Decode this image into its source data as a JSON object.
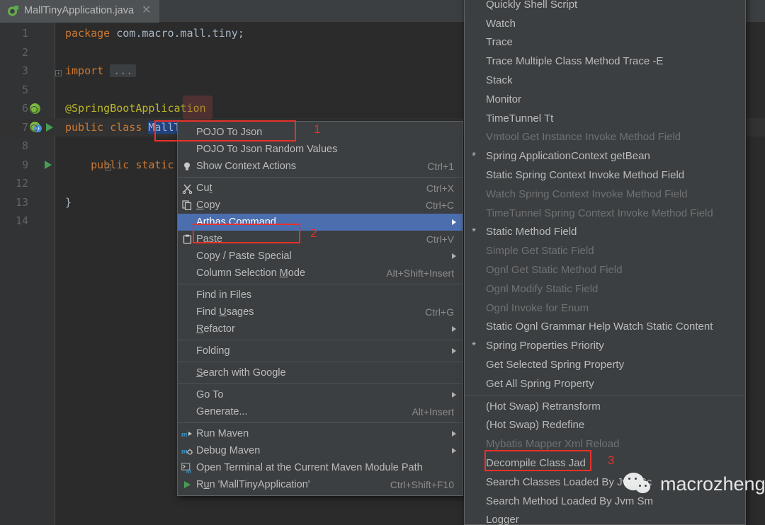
{
  "window": {
    "bg_color": "#2b2b2b",
    "accent_color": "#4b6eaf",
    "annotation_color": "#e8312a"
  },
  "editor": {
    "tab": {
      "label": "MallTinyApplication.java",
      "icon": "spring-boot-class-icon",
      "close_icon": "close-icon"
    },
    "lines": [
      {
        "num": "1",
        "tokens": [
          {
            "t": "package ",
            "c": "kw"
          },
          {
            "t": "com.macro.mall.tiny;",
            "c": "plain"
          }
        ]
      },
      {
        "num": "2",
        "tokens": []
      },
      {
        "num": "3",
        "tokens": [
          {
            "t": "import ",
            "c": "kw"
          },
          {
            "t": "...",
            "c": "fold"
          }
        ]
      },
      {
        "num": "5",
        "tokens": []
      },
      {
        "num": "6",
        "tokens": [
          {
            "t": "@SpringBootApplication",
            "c": "anno"
          }
        ]
      },
      {
        "num": "7",
        "tokens": [
          {
            "t": "public class ",
            "c": "kw"
          },
          {
            "t": "MallTinyApplication",
            "c": "sel"
          },
          {
            "t": " {",
            "c": "plain"
          }
        ]
      },
      {
        "num": "8",
        "tokens": []
      },
      {
        "num": "9",
        "tokens": [
          {
            "t": "    public static void main(String[] args);",
            "c": "kw9"
          }
        ]
      },
      {
        "num": "12",
        "tokens": []
      },
      {
        "num": "13",
        "tokens": [
          {
            "t": "}",
            "c": "plain"
          }
        ]
      },
      {
        "num": "14",
        "tokens": []
      }
    ]
  },
  "context_menu": {
    "items": [
      {
        "label": "POJO To Json",
        "icon": "",
        "shortcut": "",
        "type": "item"
      },
      {
        "label": "POJO To Json Random Values",
        "icon": "",
        "shortcut": "",
        "type": "item"
      },
      {
        "label": "Show Context Actions",
        "icon": "lightbulb-icon",
        "shortcut": "Ctrl+1",
        "type": "item"
      },
      {
        "type": "separator"
      },
      {
        "label": "Cut",
        "icon": "scissors-icon",
        "shortcut": "Ctrl+X",
        "type": "item",
        "mnemonic": "t"
      },
      {
        "label": "Copy",
        "icon": "copy-icon",
        "shortcut": "Ctrl+C",
        "type": "item",
        "mnemonic": "C"
      },
      {
        "label": "Arthas Command",
        "icon": "",
        "shortcut": "",
        "type": "item",
        "submenu": true,
        "selected": true
      },
      {
        "label": "Paste",
        "icon": "clipboard-icon",
        "shortcut": "Ctrl+V",
        "type": "item",
        "mnemonic": "P"
      },
      {
        "label": "Copy / Paste Special",
        "icon": "",
        "shortcut": "",
        "type": "item",
        "submenu": true
      },
      {
        "label": "Column Selection Mode",
        "icon": "",
        "shortcut": "Alt+Shift+Insert",
        "type": "item",
        "mnemonic": "M"
      },
      {
        "type": "separator"
      },
      {
        "label": "Find in Files",
        "icon": "",
        "shortcut": "",
        "type": "item"
      },
      {
        "label": "Find Usages",
        "icon": "",
        "shortcut": "Ctrl+G",
        "type": "item",
        "mnemonic": "U"
      },
      {
        "label": "Refactor",
        "icon": "",
        "shortcut": "",
        "type": "item",
        "submenu": true,
        "mnemonic": "R"
      },
      {
        "type": "separator"
      },
      {
        "label": "Folding",
        "icon": "",
        "shortcut": "",
        "type": "item",
        "submenu": true
      },
      {
        "type": "separator"
      },
      {
        "label": "Search with Google",
        "icon": "",
        "shortcut": "",
        "type": "item",
        "mnemonic": "S"
      },
      {
        "type": "separator"
      },
      {
        "label": "Go To",
        "icon": "",
        "shortcut": "",
        "type": "item",
        "submenu": true
      },
      {
        "label": "Generate...",
        "icon": "",
        "shortcut": "Alt+Insert",
        "type": "item"
      },
      {
        "type": "separator"
      },
      {
        "label": "Run Maven",
        "icon": "maven-run-icon",
        "shortcut": "",
        "type": "item",
        "submenu": true
      },
      {
        "label": "Debug Maven",
        "icon": "maven-debug-icon",
        "shortcut": "",
        "type": "item",
        "submenu": true
      },
      {
        "label": "Open Terminal at the Current Maven Module Path",
        "icon": "terminal-maven-icon",
        "shortcut": "",
        "type": "item"
      },
      {
        "label": "Run 'MallTinyApplication'",
        "icon": "run-icon",
        "shortcut": "Ctrl+Shift+F10",
        "type": "item",
        "mnemonic": "u"
      }
    ]
  },
  "submenu": {
    "title": "Arthas Command",
    "items": [
      {
        "label": "Quickly Shell Script",
        "star": false,
        "disabled": false
      },
      {
        "label": "Watch",
        "star": false,
        "disabled": false
      },
      {
        "label": "Trace",
        "star": false,
        "disabled": false
      },
      {
        "label": "Trace Multiple Class Method Trace -E",
        "star": false,
        "disabled": false
      },
      {
        "label": "Stack",
        "star": false,
        "disabled": false
      },
      {
        "label": "Monitor",
        "star": false,
        "disabled": false
      },
      {
        "label": "TimeTunnel Tt",
        "star": false,
        "disabled": false
      },
      {
        "label": "Vmtool Get Instance Invoke Method Field",
        "star": false,
        "disabled": true
      },
      {
        "label": "Spring ApplicationContext getBean",
        "star": true,
        "disabled": false
      },
      {
        "label": "Static Spring Context Invoke  Method Field",
        "star": false,
        "disabled": false
      },
      {
        "label": "Watch Spring Context Invoke Method Field",
        "star": false,
        "disabled": true
      },
      {
        "label": "TimeTunnel Spring Context Invoke Method Field",
        "star": false,
        "disabled": true
      },
      {
        "label": "Static Method Field",
        "star": true,
        "disabled": false
      },
      {
        "label": "Simple Get Static Field",
        "star": false,
        "disabled": true
      },
      {
        "label": "Ognl Get Static Method Field",
        "star": false,
        "disabled": true
      },
      {
        "label": "Ognl Modify Static Field",
        "star": false,
        "disabled": true
      },
      {
        "label": "Ognl Invoke for Enum",
        "star": false,
        "disabled": true
      },
      {
        "label": "Static Ognl Grammar Help Watch Static Content",
        "star": false,
        "disabled": false
      },
      {
        "label": "Spring Properties Priority",
        "star": true,
        "disabled": false
      },
      {
        "label": "Get Selected Spring Property",
        "star": false,
        "disabled": false
      },
      {
        "label": "Get All Spring Property",
        "star": false,
        "disabled": false
      },
      {
        "type": "separator"
      },
      {
        "label": "(Hot Swap) Retransform",
        "star": false,
        "disabled": false
      },
      {
        "label": "(Hot Swap) Redefine",
        "star": false,
        "disabled": false
      },
      {
        "label": "Mybatis Mapper Xml Reload",
        "star": false,
        "disabled": true
      },
      {
        "label": "Decompile Class Jad",
        "star": false,
        "disabled": false
      },
      {
        "label": "Search Classes Loaded By Jvm Sc",
        "star": false,
        "disabled": false
      },
      {
        "label": "Search Method Loaded By Jvm Sm",
        "star": false,
        "disabled": false
      },
      {
        "label": "Logger",
        "star": false,
        "disabled": false
      }
    ]
  },
  "annotations": [
    {
      "number": "1",
      "target": "class-name-and-pojo-to-json"
    },
    {
      "number": "2",
      "target": "arthas-command-menu-item"
    },
    {
      "number": "3",
      "target": "decompile-class-jad-item"
    }
  ],
  "watermark": {
    "text": "macrozheng",
    "icon": "wechat-icon"
  }
}
